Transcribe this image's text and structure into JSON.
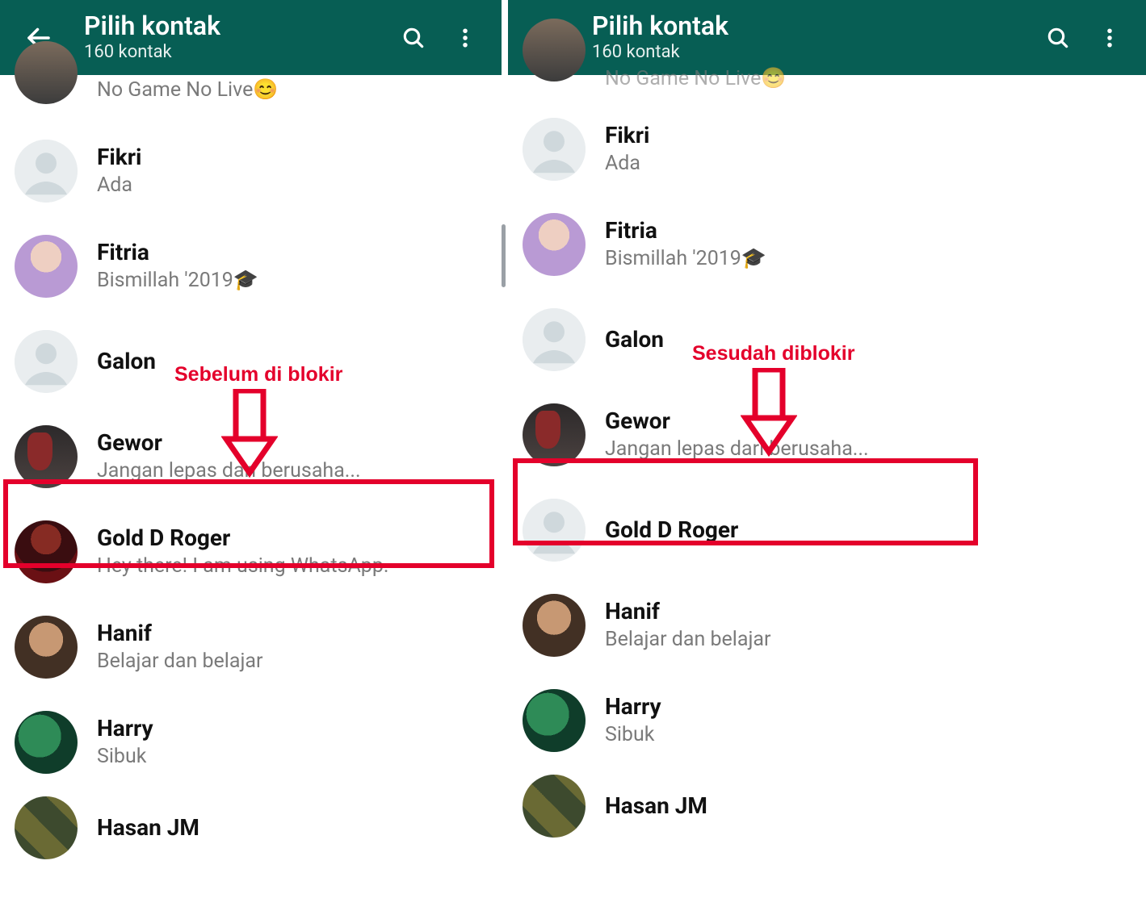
{
  "header": {
    "title": "Pilih kontak",
    "subtitle": "160 kontak"
  },
  "annotations": {
    "left_label": "Sebelum di blokir",
    "right_label": "Sesudah diblokir"
  },
  "left": {
    "contacts": [
      {
        "name": "",
        "status": "No Game No Live😊",
        "avatar": "partial"
      },
      {
        "name": "Fikri",
        "status": "Ada",
        "avatar": "default"
      },
      {
        "name": "Fitria",
        "status": "Bismillah '2019🎓",
        "avatar": "hijab"
      },
      {
        "name": "Galon",
        "status": "",
        "avatar": "default"
      },
      {
        "name": "Gewor",
        "status": "Jangan lepas dari berusaha...",
        "avatar": "sing"
      },
      {
        "name": "Gold D Roger",
        "status": "Hey there! I am using WhatsApp.",
        "avatar": "roger"
      },
      {
        "name": "Hanif",
        "status": "Belajar dan belajar",
        "avatar": "kid"
      },
      {
        "name": "Harry",
        "status": "Sibuk",
        "avatar": "green1"
      },
      {
        "name": "Hasan JM",
        "status": "",
        "avatar": "camo"
      }
    ]
  },
  "right": {
    "contacts": [
      {
        "name": "",
        "status": "No Game No Live😊",
        "avatar": "partial"
      },
      {
        "name": "Fikri",
        "status": "Ada",
        "avatar": "default"
      },
      {
        "name": "Fitria",
        "status": "Bismillah '2019🎓",
        "avatar": "hijab"
      },
      {
        "name": "Galon",
        "status": "",
        "avatar": "default"
      },
      {
        "name": "Gewor",
        "status": "Jangan lepas dari berusaha...",
        "avatar": "sing"
      },
      {
        "name": "Gold D Roger",
        "status": "",
        "avatar": "default"
      },
      {
        "name": "Hanif",
        "status": "Belajar dan belajar",
        "avatar": "kid"
      },
      {
        "name": "Harry",
        "status": "Sibuk",
        "avatar": "green1"
      },
      {
        "name": "Hasan JM",
        "status": "",
        "avatar": "camo"
      }
    ]
  }
}
